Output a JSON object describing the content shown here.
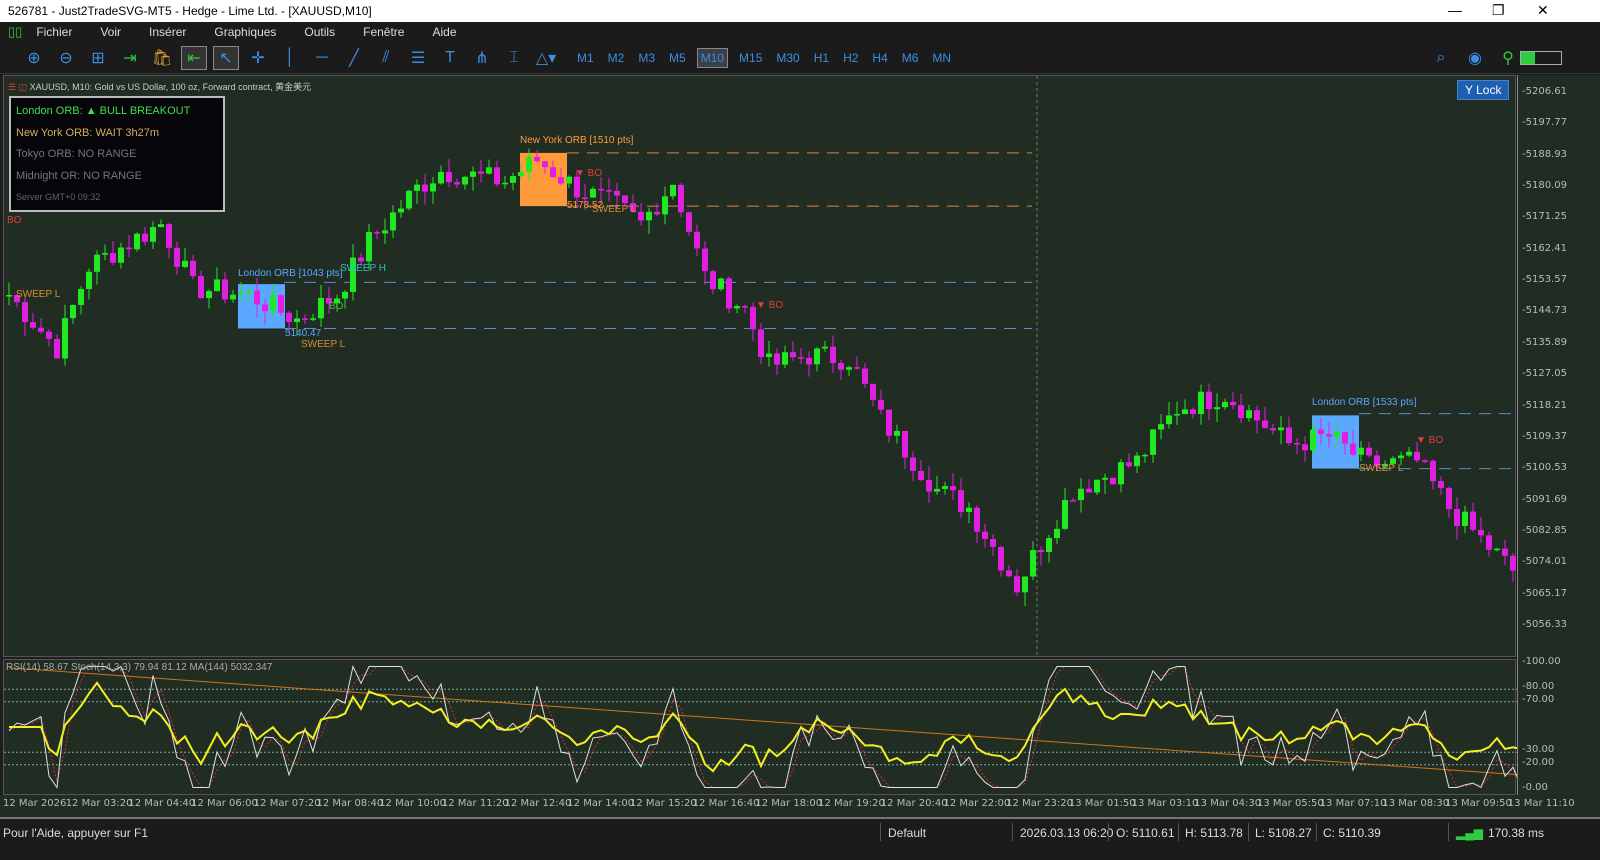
{
  "window": {
    "title": "526781 - Just2TradeSVG-MT5 - Hedge - Lime Ltd. - [XAUUSD,M10]",
    "minimize": "—",
    "restore": "❐",
    "close": "✕"
  },
  "menu": [
    "Fichier",
    "Voir",
    "Insérer",
    "Graphiques",
    "Outils",
    "Fenêtre",
    "Aide"
  ],
  "toolbar": {
    "icons": [
      "zoom-in",
      "zoom-out",
      "tile-windows",
      "chart-shift",
      "market",
      "autoscroll",
      "cursor",
      "crosshair",
      "vertical-line",
      "horizontal-line",
      "trendline",
      "channel",
      "fibonacci",
      "text",
      "pitchfork",
      "text-label",
      "shapes"
    ],
    "timeframes": [
      "M1",
      "M2",
      "M3",
      "M5",
      "M10",
      "M15",
      "M30",
      "H1",
      "H2",
      "H4",
      "M6",
      "MN"
    ],
    "active_timeframe": "M10"
  },
  "chart": {
    "symbol_label": "XAUUSD, M10:  Gold vs US Dollar, 100 oz, Forward contract, 黄金美元",
    "lock_button": "Y Lock",
    "price_ticks": [
      "5206.61",
      "5197.77",
      "5188.93",
      "5180.09",
      "5171.25",
      "5162.41",
      "5153.57",
      "5144.73",
      "5135.89",
      "5127.05",
      "5118.21",
      "5109.37",
      "5100.53",
      "5091.69",
      "5082.85",
      "5074.01",
      "5065.17",
      "5056.33"
    ],
    "price_range": [
      5056.33,
      5206.61
    ],
    "price_path": [
      [
        0,
        5150
      ],
      [
        6,
        5135
      ],
      [
        10,
        5158
      ],
      [
        19,
        5170
      ],
      [
        23,
        5152
      ],
      [
        30,
        5150
      ],
      [
        36,
        5143
      ],
      [
        41,
        5150
      ],
      [
        45,
        5165
      ],
      [
        51,
        5180
      ],
      [
        54,
        5185
      ],
      [
        62,
        5182
      ],
      [
        66,
        5188
      ],
      [
        71,
        5180
      ],
      [
        76,
        5175
      ],
      [
        79,
        5170
      ],
      [
        83,
        5182
      ],
      [
        87,
        5155
      ],
      [
        92,
        5146
      ],
      [
        95,
        5130
      ],
      [
        100,
        5133
      ],
      [
        105,
        5132
      ],
      [
        109,
        5115
      ],
      [
        116,
        5095
      ],
      [
        120,
        5090
      ],
      [
        126,
        5068
      ],
      [
        129,
        5080
      ],
      [
        133,
        5095
      ],
      [
        141,
        5103
      ],
      [
        146,
        5118
      ],
      [
        152,
        5122
      ],
      [
        160,
        5108
      ],
      [
        165,
        5110
      ],
      [
        170,
        5102
      ],
      [
        176,
        5103
      ],
      [
        180,
        5090
      ],
      [
        189,
        5070
      ]
    ],
    "annotations": {
      "bo_left": "BO",
      "sweep_l_left": "SWEEP L",
      "london_orb_1": "London ORB [1043 pts]",
      "london_price": "5140.47",
      "sweep_h": "SWEEP H",
      "bo_up": "BO",
      "sweep_l_2": "SWEEP L",
      "ny_orb": "New York ORB [1510 pts]",
      "bo_down_1": "▼ BO",
      "ny_price": "5178.52",
      "sweep_l_3": "SWEEP L",
      "bo_down_2": "▼ BO",
      "london_orb_2": "London ORB [1533 pts]",
      "sweep_l_4": "SWEEP L",
      "bo_down_3": "▼ BO"
    },
    "colors": {
      "bull": "#22e822",
      "bear": "#e020e0",
      "london": "#5aa8ff",
      "newyork": "#ff9a3c"
    }
  },
  "panel": {
    "london": "London ORB:  ▲ BULL BREAKOUT",
    "newyork": "New York ORB:  WAIT 3h27m",
    "tokyo": "Tokyo ORB:  NO RANGE",
    "midnight": "Midnight OR:  NO RANGE",
    "server": "Server GMT+0   09:32"
  },
  "indicator": {
    "label": "RSI(14) 58.67 Stoch(14,3,3) 79.94 81.12 MA(144) 5032.347",
    "ticks": [
      "100.00",
      "80.00",
      "70.00",
      "30.00",
      "20.00",
      "0.00"
    ]
  },
  "time_axis": [
    "12 Mar 2026",
    "12 Mar 03:20",
    "12 Mar 04:40",
    "12 Mar 06:00",
    "12 Mar 07:20",
    "12 Mar 08:40",
    "12 Mar 10:00",
    "12 Mar 11:20",
    "12 Mar 12:40",
    "12 Mar 14:00",
    "12 Mar 15:20",
    "12 Mar 16:40",
    "12 Mar 18:00",
    "12 Mar 19:20",
    "12 Mar 20:40",
    "12 Mar 22:00",
    "12 Mar 23:20",
    "13 Mar 01:50",
    "13 Mar 03:10",
    "13 Mar 04:30",
    "13 Mar 05:50",
    "13 Mar 07:10",
    "13 Mar 08:30",
    "13 Mar 09:50",
    "13 Mar 11:10"
  ],
  "status": {
    "help": "Pour l'Aide, appuyer sur F1",
    "profile": "Default",
    "datetime": "2026.03.13 06:20",
    "open": "O: 5110.61",
    "high": "H: 5113.78",
    "low": "L: 5108.27",
    "close": "C: 5110.39",
    "ping": "170.38 ms"
  }
}
